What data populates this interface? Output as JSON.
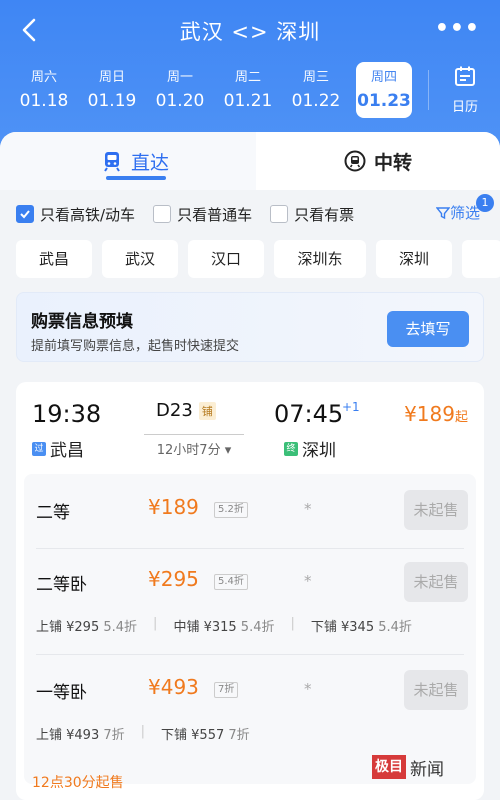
{
  "header": {
    "title": "武汉 <> 深圳",
    "more": "•••",
    "calendar_label": "日历",
    "dates": [
      {
        "weekday": "周六",
        "date": "01.18",
        "selected": false
      },
      {
        "weekday": "周日",
        "date": "01.19",
        "selected": false
      },
      {
        "weekday": "周一",
        "date": "01.20",
        "selected": false
      },
      {
        "weekday": "周二",
        "date": "01.21",
        "selected": false
      },
      {
        "weekday": "周三",
        "date": "01.22",
        "selected": false
      },
      {
        "weekday": "周四",
        "date": "01.23",
        "selected": true
      }
    ]
  },
  "tabs": {
    "direct": "直达",
    "transfer": "中转"
  },
  "filters": {
    "high_speed": "只看高铁/动车",
    "regular": "只看普通车",
    "available": "只看有票",
    "screen": "筛选",
    "screen_count": "1"
  },
  "stations": [
    "武昌",
    "武汉",
    "汉口",
    "深圳东",
    "深圳"
  ],
  "prefill": {
    "title": "购票信息预填",
    "subtitle": "提前填写购票信息，起售时快速提交",
    "button": "去填写"
  },
  "train": {
    "dep_time": "19:38",
    "dep_tag": "过",
    "dep_station": "武昌",
    "train_no": "D23",
    "sleeper_tag": "铺",
    "duration": "12小时7分",
    "arr_time": "07:45",
    "day_plus": "+1",
    "arr_tag": "终",
    "arr_station": "深圳",
    "min_price": "¥189",
    "min_price_suffix": "起"
  },
  "seats": [
    {
      "name": "二等",
      "price": "¥189",
      "discount": "5.2折",
      "mark": "*",
      "status": "未起售"
    },
    {
      "name": "二等卧",
      "price": "¥295",
      "discount": "5.4折",
      "mark": "*",
      "status": "未起售",
      "berths": [
        {
          "label": "上铺 ¥295",
          "disc": "5.4折"
        },
        {
          "label": "中铺 ¥315",
          "disc": "5.4折"
        },
        {
          "label": "下铺 ¥345",
          "disc": "5.4折"
        }
      ]
    },
    {
      "name": "一等卧",
      "price": "¥493",
      "discount": "7折",
      "mark": "*",
      "status": "未起售",
      "berths": [
        {
          "label": "上铺 ¥493",
          "disc": "7折"
        },
        {
          "label": "下铺 ¥557",
          "disc": "7折"
        }
      ]
    }
  ],
  "sale_time": "12点30分起售",
  "watermark": {
    "part1": "极目",
    "part2": "新闻"
  }
}
